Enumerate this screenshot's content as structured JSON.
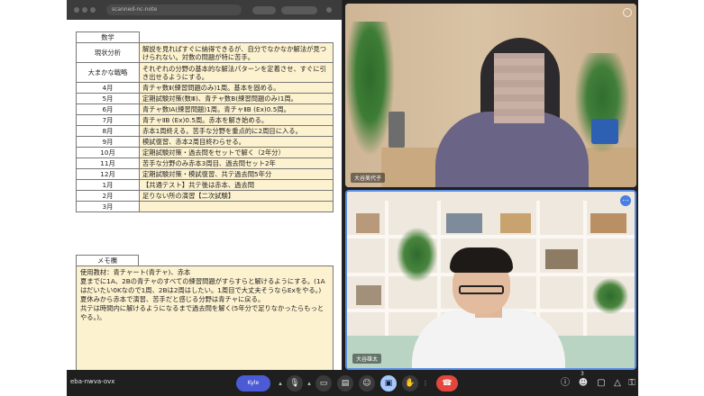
{
  "share": {
    "url_text": "scanned-nc-note"
  },
  "plan": {
    "subject": "数学",
    "rows": [
      {
        "label": "現状分析",
        "content": "解説を見ればすぐに納得できるが、自分でなかなか解法が見つけられない。対数の問題が特に苦手。"
      },
      {
        "label": "大まかな戦略",
        "content": "それぞれの分野の基本的な解法パターンを定着させ、すぐに引き出せるようにする。"
      },
      {
        "label": "4月",
        "content": "青チャ数Ⅱ(練習問題のみ)1周。基本を固める。"
      },
      {
        "label": "5月",
        "content": "定期試験対策(数Ⅲ)、青チャ数B(練習問題のみ)1周。"
      },
      {
        "label": "6月",
        "content": "青チャ数ⅠA(練習問題)1周。青チャⅡB (Ex)0.5周。"
      },
      {
        "label": "7月",
        "content": "青チャⅡB (Ex)0.5周。赤本を解き始める。"
      },
      {
        "label": "8月",
        "content": "赤本1周終える。苦手な分野を重点的に2周目に入る。"
      },
      {
        "label": "9月",
        "content": "模試復習、赤本2周目終わらせる。"
      },
      {
        "label": "10月",
        "content": "定期試験対策・過去問をセットで解く（2年分）"
      },
      {
        "label": "11月",
        "content": "苦手な分野のみ赤本3周目、過去問セット2年"
      },
      {
        "label": "12月",
        "content": "定期試験対策・模試復習、共テ過去問5年分"
      },
      {
        "label": "1月",
        "content": "【共通テスト】共テ後は赤本、過去問"
      },
      {
        "label": "2月",
        "content": "足りない所の演習【二次試験】"
      },
      {
        "label": "3月",
        "content": ""
      }
    ]
  },
  "memo": {
    "label": "メモ欄",
    "text": "使用教材：青チャート(青チャ)、赤本\n夏までに1A、2Bの青チャのすべての練習問題がすらすらと解けるようにする。(1Aはだいたい0Kなので1周、2Bは2周はしたい。1周目で大丈夫そうならExをやる。)\n夏休みから赤本で演習、苦手だと感じる分野は青チャに戻る。\n共テは時間内に解けるようになるまで過去問を解く(5年分で足りなかったらもっとやる。)。"
  },
  "tiles": {
    "top_name": "大谷美代子",
    "bottom_name": "大谷雄太"
  },
  "controls": {
    "meeting_code": "eba-nwva-ovx",
    "label_chip": "Kyle",
    "participants_count": "3"
  },
  "colors": {
    "cell_bg": "#fdf2cf",
    "end_call": "#e2463c",
    "active": "#a8c7fa",
    "tile_border": "#5b8ee6"
  },
  "icons": [
    "mic-icon",
    "camera-icon",
    "captions-icon",
    "emoji-icon",
    "present-icon",
    "raise-hand-icon",
    "more-icon",
    "end-call-icon",
    "info-icon",
    "people-icon",
    "chat-icon",
    "activities-icon",
    "host-controls-icon"
  ]
}
